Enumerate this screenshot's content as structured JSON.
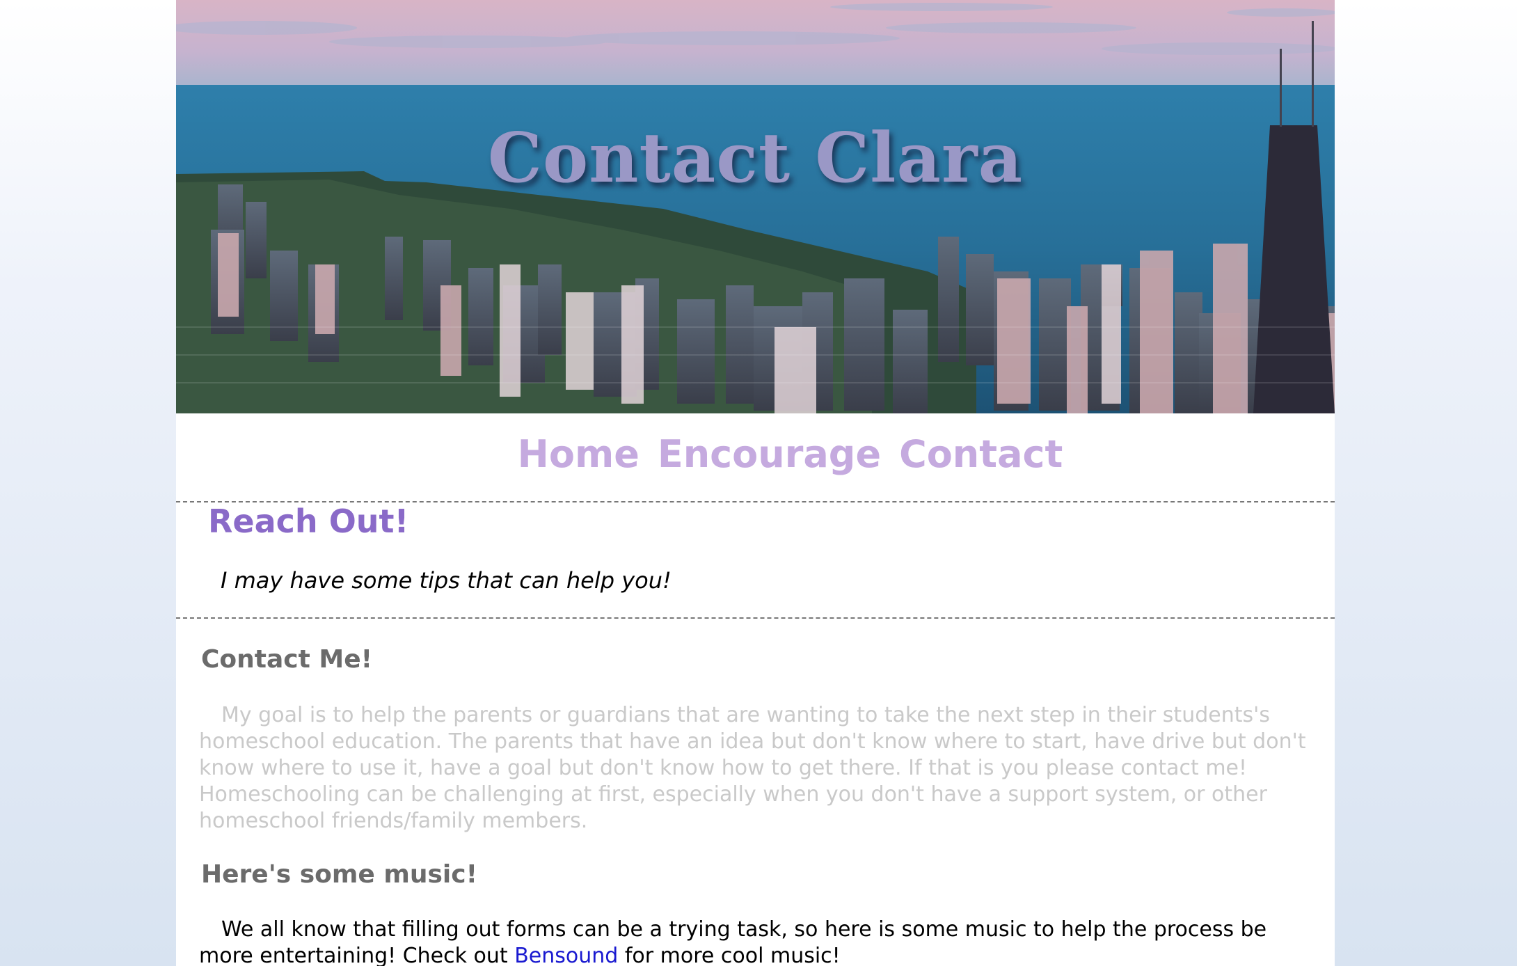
{
  "hero": {
    "title": "Contact Clara"
  },
  "nav": {
    "items": [
      {
        "label": "Home"
      },
      {
        "label": "Encourage"
      },
      {
        "label": "Contact"
      }
    ]
  },
  "reach_out": {
    "title": "Reach Out!",
    "subtitle": "I may have some tips that can help you!"
  },
  "contact": {
    "heading": "Contact Me!",
    "body": "My goal is to help the parents or guardians that are wanting to take the next step in their students's homeschool education. The parents that have an idea but don't know where to start, have drive but don't know where to use it, have a goal but don't know how to get there. If that is you please contact me! Homeschooling can be challenging at first, especially when you don't have a support system, or other homeschool friends/family members."
  },
  "music": {
    "heading": "Here's some music!",
    "body_before": "We all know that filling out forms can be a trying task, so here is some music to help the process be more entertaining! Check out ",
    "link_label": "Bensound",
    "body_after": " for more cool music!"
  },
  "colors": {
    "page_bg_top": "#ffffff",
    "page_bg_bottom": "#d8e3f1",
    "hero_title": "#9a98c6",
    "nav_link": "#c5aadf",
    "reach_title": "#8a6ac8",
    "section_heading": "#6b6b6b",
    "faded_text": "#c9c9c9",
    "link": "#1a1ad0"
  }
}
